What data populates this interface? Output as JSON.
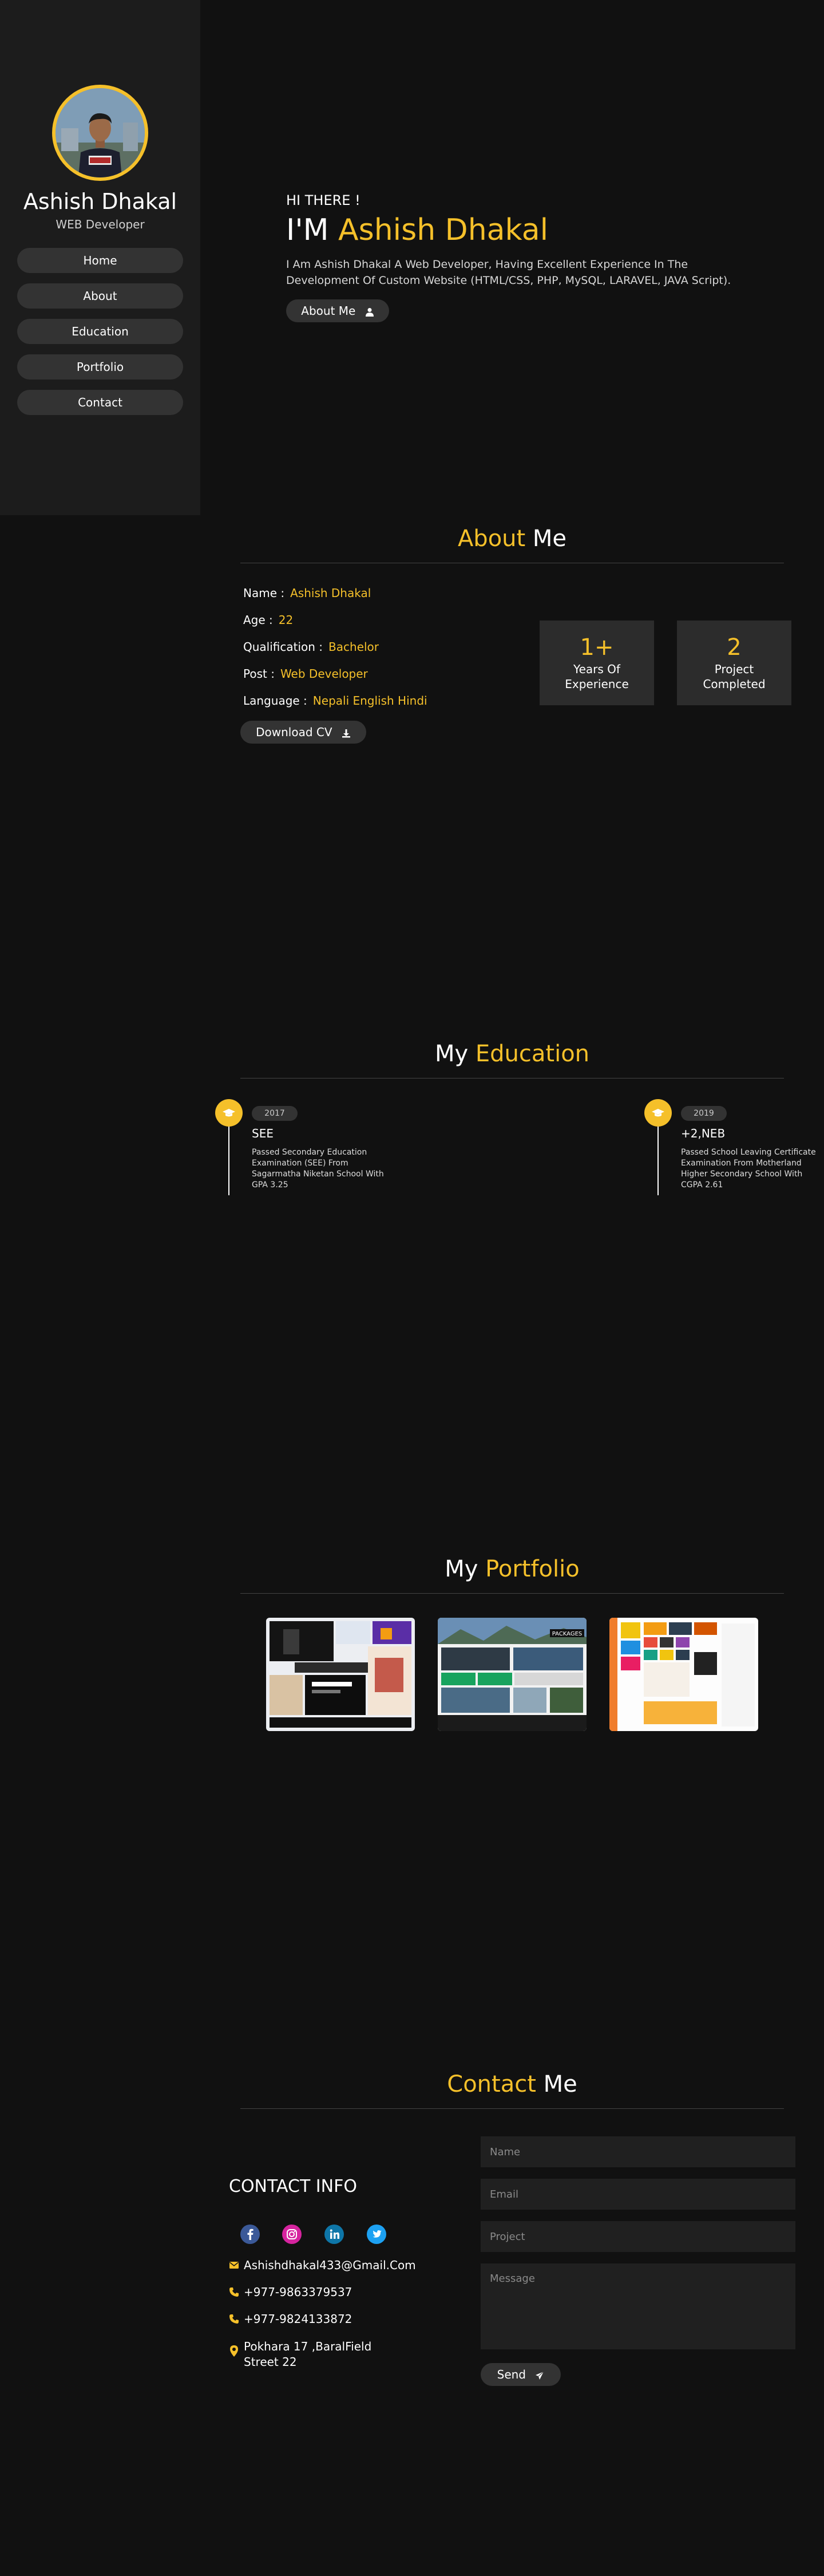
{
  "sidebar": {
    "name": "Ashish Dhakal",
    "role": "WEB Developer",
    "nav": [
      "Home",
      "About",
      "Education",
      "Portfolio",
      "Contact"
    ]
  },
  "hero": {
    "greeting": "HI THERE !",
    "title_prefix": "I'M",
    "title_name": "Ashish Dhakal",
    "description": "I Am Ashish Dhakal A Web Developer, Having Excellent Experience In The Development Of Custom Website (HTML/CSS, PHP, MySQL, LARAVEL, JAVA Script).",
    "button": "About Me",
    "button_icon": "user-icon"
  },
  "about": {
    "title_accent": "About",
    "title_rest": "Me",
    "rows": [
      {
        "label": "Name :",
        "value": "Ashish Dhakal"
      },
      {
        "label": "Age :",
        "value": "22"
      },
      {
        "label": "Qualification :",
        "value": "Bachelor"
      },
      {
        "label": "Post :",
        "value": "Web Developer"
      },
      {
        "label": "Language :",
        "value": "Nepali English Hindi"
      }
    ],
    "download_button": "Download CV",
    "download_icon": "download-icon",
    "stats": [
      {
        "number": "1+",
        "label_line1": "Years Of",
        "label_line2": "Experience"
      },
      {
        "number": "2",
        "label_line1": "Project",
        "label_line2": "Completed"
      }
    ]
  },
  "education": {
    "title_rest": "My",
    "title_accent": "Education",
    "items": [
      {
        "year": "2017",
        "title": "SEE",
        "description": "Passed Secondary Education Examination (SEE) From Sagarmatha Niketan School With GPA 3.25",
        "icon": "graduation-cap-icon"
      },
      {
        "year": "2019",
        "title": "+2,NEB",
        "description": "Passed School Leaving Certificate Examination From Motherland Higher Secondary School With CGPA 2.61",
        "icon": "graduation-cap-icon"
      }
    ]
  },
  "portfolio": {
    "title_rest": "My",
    "title_accent": "Portfolio",
    "thumb_caption": "PACKAGES"
  },
  "contact": {
    "title_accent": "Contact",
    "title_rest": "Me",
    "info_title": "CONTACT INFO",
    "socials": [
      "facebook-icon",
      "instagram-icon",
      "linkedin-icon",
      "twitter-icon"
    ],
    "email": "Ashishdhakal433@Gmail.Com",
    "phone1": "+977-9863379537",
    "phone2": "+977-9824133872",
    "address_line1": "Pokhara 17 ,BaralField",
    "address_line2": "Street 22",
    "form": {
      "name_placeholder": "Name",
      "email_placeholder": "Email",
      "project_placeholder": "Project",
      "message_placeholder": "Message",
      "send_button": "Send"
    }
  },
  "colors": {
    "accent": "#f5c02a",
    "background": "#111111",
    "sidebar": "#1c1c1c",
    "button": "#333333"
  }
}
